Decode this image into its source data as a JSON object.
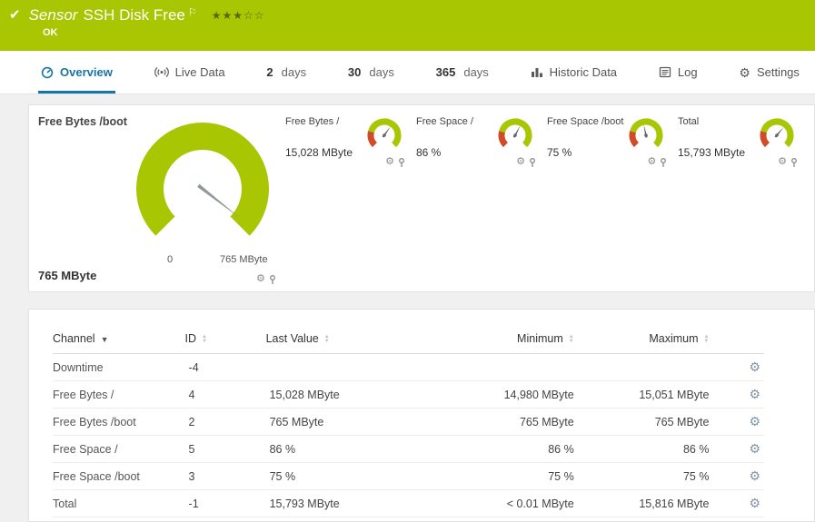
{
  "colors": {
    "brand_green": "#a8c602",
    "tab_blue": "#1774a8",
    "gauge_red": "#d14b29",
    "needle_gray": "#90989b"
  },
  "header": {
    "title_prefix": "Sensor",
    "title": "SSH Disk Free",
    "status": "OK",
    "stars": "★★★☆☆"
  },
  "tabs": [
    {
      "label": "Overview",
      "active": true
    },
    {
      "label": "Live Data"
    },
    {
      "number": "2",
      "unit": "days"
    },
    {
      "number": "30",
      "unit": "days"
    },
    {
      "number": "365",
      "unit": "days"
    },
    {
      "label": "Historic Data"
    },
    {
      "label": "Log"
    },
    {
      "label": "Settings"
    }
  ],
  "gauges": {
    "main": {
      "label": "Free Bytes /boot",
      "value": "765 MByte",
      "scale_min": "0",
      "scale_max": "765 MByte"
    },
    "minis": [
      {
        "label": "Free Bytes /",
        "value": "15,028 MByte"
      },
      {
        "label": "Free Space /",
        "value": "86 %"
      },
      {
        "label": "Free Space /boot",
        "value": "75 %"
      },
      {
        "label": "Total",
        "value": "15,793 MByte"
      }
    ]
  },
  "table": {
    "columns": {
      "channel": "Channel",
      "id": "ID",
      "last": "Last Value",
      "min": "Minimum",
      "max": "Maximum"
    },
    "rows": [
      {
        "channel": "Downtime",
        "id": "-4",
        "last": "",
        "min": "",
        "max": ""
      },
      {
        "channel": "Free Bytes /",
        "id": "4",
        "last": "15,028 MByte",
        "min": "14,980 MByte",
        "max": "15,051 MByte"
      },
      {
        "channel": "Free Bytes /boot",
        "id": "2",
        "last": "765 MByte",
        "min": "765 MByte",
        "max": "765 MByte"
      },
      {
        "channel": "Free Space /",
        "id": "5",
        "last": "86 %",
        "min": "86 %",
        "max": "86 %"
      },
      {
        "channel": "Free Space /boot",
        "id": "3",
        "last": "75 %",
        "min": "75 %",
        "max": "75 %"
      },
      {
        "channel": "Total",
        "id": "-1",
        "last": "15,793 MByte",
        "min": "< 0.01 MByte",
        "max": "15,816 MByte"
      }
    ]
  }
}
